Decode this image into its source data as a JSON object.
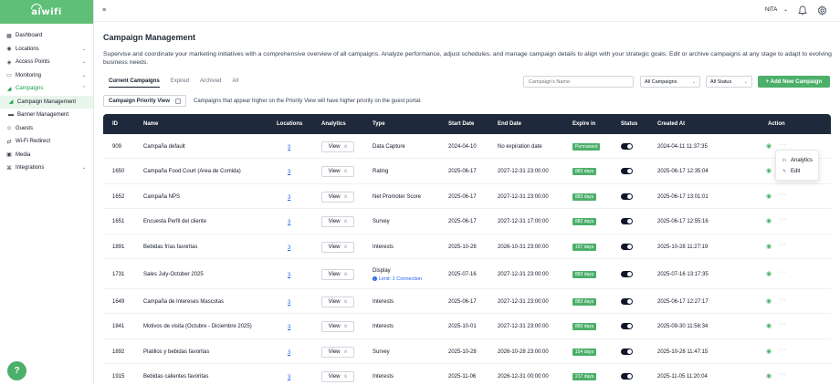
{
  "brand": {
    "name": "aiwifi"
  },
  "sidebar": {
    "items": [
      {
        "label": "Dashboard",
        "icon": "dashboard-icon",
        "glyph": "▦"
      },
      {
        "label": "Locations",
        "icon": "location-pin-icon",
        "glyph": "◉",
        "chevron": "⌄"
      },
      {
        "label": "Access Points",
        "icon": "access-point-icon",
        "glyph": "◈",
        "chevron": "⌄"
      },
      {
        "label": "Monitoring",
        "icon": "monitor-icon",
        "glyph": "▭",
        "chevron": "⌄"
      },
      {
        "label": "Campaigns",
        "icon": "megaphone-icon",
        "glyph": "◢",
        "chevron": "⌃"
      },
      {
        "label": "Campaign Management",
        "icon": "megaphone-icon",
        "glyph": "◢"
      },
      {
        "label": "Banner Management",
        "icon": "banner-icon",
        "glyph": "▬"
      },
      {
        "label": "Guests",
        "icon": "guests-icon",
        "glyph": "☺"
      },
      {
        "label": "Wi-Fi Redirect",
        "icon": "redirect-icon",
        "glyph": "⇄"
      },
      {
        "label": "Media",
        "icon": "media-icon",
        "glyph": "▣"
      },
      {
        "label": "Integrations",
        "icon": "integrations-icon",
        "glyph": "⌘",
        "chevron": "⌄"
      }
    ],
    "help_label": "?"
  },
  "topbar": {
    "menu_glyph": "≡",
    "user_name": "NITA",
    "user_chevron": "⌄"
  },
  "page": {
    "title": "Campaign Management",
    "description": "Supervise and coordinate your marketing initiatives with a comprehensive overview of all campaigns. Analyze performance, adjust schedules, and manage campaign details to align with your strategic goals. Edit or archive campaigns at any stage to adapt to evolving business needs.",
    "tabs": [
      "Current Campaigns",
      "Expired",
      "Archived",
      "All"
    ],
    "search_placeholder": "Campaign's Name",
    "filter_type": "All Campaigns",
    "filter_status": "All Status",
    "add_button": "+ Add New Campaign",
    "priority_label": "Campaign Priority View",
    "priority_note": "Campaigns that appear higher on the Priority View will have higher priority on the guest portal."
  },
  "table": {
    "headers": [
      "ID",
      "Name",
      "Locations",
      "Analytics",
      "Type",
      "Start Date",
      "End Date",
      "Expire in",
      "Status",
      "Created At",
      "Action"
    ],
    "view_label": "View",
    "view_glyph": "ılı",
    "eye_glyph": "◉",
    "more_glyph": "···",
    "rows": [
      {
        "id": "909",
        "name": "Campaña default",
        "locations": "3",
        "type": "Data Capture",
        "start": "2024-04-10",
        "end": "No expiration date",
        "expire": "Permanent",
        "created": "2024-04-11 11:37:35"
      },
      {
        "id": "1650",
        "name": "Campaña Food Court (Area de Comida)",
        "locations": "3",
        "type": "Rating",
        "start": "2025-06-17",
        "end": "2027-12-31 23:00:00",
        "expire": "883 days",
        "created": "2025-06-17 12:35:04"
      },
      {
        "id": "1652",
        "name": "Campaña NPS",
        "locations": "3",
        "type": "Net Promoter Score",
        "start": "2025-06-17",
        "end": "2027-12-31 23:00:00",
        "expire": "883 days",
        "created": "2025-06-17 13:01:01"
      },
      {
        "id": "1651",
        "name": "Encuesta Perfil del cliente",
        "locations": "3",
        "type": "Survey",
        "start": "2025-06-17",
        "end": "2027-12-31 17:00:00",
        "expire": "882 days",
        "created": "2025-06-17 12:55:16"
      },
      {
        "id": "1891",
        "name": "Bebidas frías favoritas",
        "locations": "3",
        "type": "Interests",
        "start": "2025-10-28",
        "end": "2026-10-31 23:00:00",
        "expire": "157 days",
        "created": "2025-10-28 11:27:19"
      },
      {
        "id": "1731",
        "name": "Sales July-October 2025",
        "locations": "3",
        "type": "Display",
        "type_sub": "Limit: 1 Connection",
        "start": "2025-07-16",
        "end": "2027-12-31 23:00:00",
        "expire": "883 days",
        "created": "2025-07-16 13:17:35"
      },
      {
        "id": "1649",
        "name": "Campaña de Intereses Mascotas",
        "locations": "3",
        "type": "Interests",
        "start": "2025-06-17",
        "end": "2027-12-31 23:00:00",
        "expire": "883 days",
        "created": "2025-06-17 12:27:17"
      },
      {
        "id": "1841",
        "name": "Motivos de visita (Octubre - Diciembre 2025)",
        "locations": "3",
        "type": "Interests",
        "start": "2025-10-01",
        "end": "2027-12-31 23:00:00",
        "expire": "883 days",
        "created": "2025-09-30 11:56:34"
      },
      {
        "id": "1892",
        "name": "Platillos y bebidas favoritas",
        "locations": "3",
        "type": "Survey",
        "start": "2025-10-28",
        "end": "2026-10-28 23:00:00",
        "expire": "154 days",
        "created": "2025-10-28 11:47:15"
      },
      {
        "id": "1915",
        "name": "Bebidas calientes favoritas",
        "locations": "3",
        "type": "Interests",
        "start": "2025-11-06",
        "end": "2026-12-31 00:00:00",
        "expire": "217 days",
        "created": "2025-11-05 11:20:04"
      }
    ]
  },
  "popover": {
    "items": [
      {
        "label": "Analytics",
        "icon": "analytics-icon",
        "glyph": "ılı"
      },
      {
        "label": "Edit",
        "icon": "pencil-icon",
        "glyph": "✎"
      }
    ]
  },
  "colors": {
    "brand_green": "#5fbf78",
    "accent_green": "#4caf6a",
    "table_header": "#1e293b",
    "link_blue": "#2563eb"
  }
}
